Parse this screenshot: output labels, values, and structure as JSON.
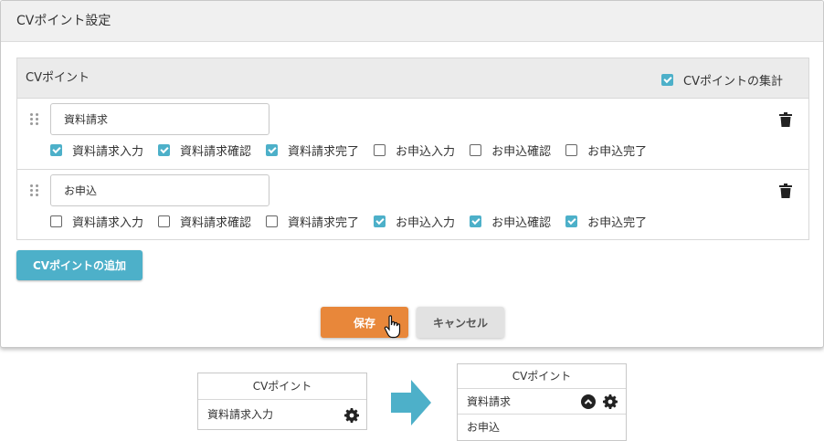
{
  "modal": {
    "title": "CVポイント設定",
    "panel_title": "CVポイント",
    "aggregate_label": "CVポイントの集計",
    "aggregate_checked": true,
    "rows": [
      {
        "name": "資料請求",
        "checks": [
          {
            "label": "資料請求入力",
            "checked": true
          },
          {
            "label": "資料請求確認",
            "checked": true
          },
          {
            "label": "資料請求完了",
            "checked": true
          },
          {
            "label": "お申込入力",
            "checked": false
          },
          {
            "label": "お申込確認",
            "checked": false
          },
          {
            "label": "お申込完了",
            "checked": false
          }
        ]
      },
      {
        "name": "お申込",
        "checks": [
          {
            "label": "資料請求入力",
            "checked": false
          },
          {
            "label": "資料請求確認",
            "checked": false
          },
          {
            "label": "資料請求完了",
            "checked": false
          },
          {
            "label": "お申込入力",
            "checked": true
          },
          {
            "label": "お申込確認",
            "checked": true
          },
          {
            "label": "お申込完了",
            "checked": true
          }
        ]
      }
    ],
    "add_button": "CVポイントの追加",
    "save_button": "保存",
    "cancel_button": "キャンセル"
  },
  "before": {
    "header": "CVポイント",
    "item": "資料請求入力"
  },
  "after": {
    "header": "CVポイント",
    "items": [
      "資料請求",
      "お申込"
    ]
  },
  "colors": {
    "accent": "#4db0c9",
    "save": "#e8873a",
    "cancel": "#e2e2e2"
  },
  "icons": [
    "drag-handle-icon",
    "trash-icon",
    "gear-icon",
    "chevron-up-icon",
    "arrow-right-icon",
    "hand-cursor-icon"
  ]
}
